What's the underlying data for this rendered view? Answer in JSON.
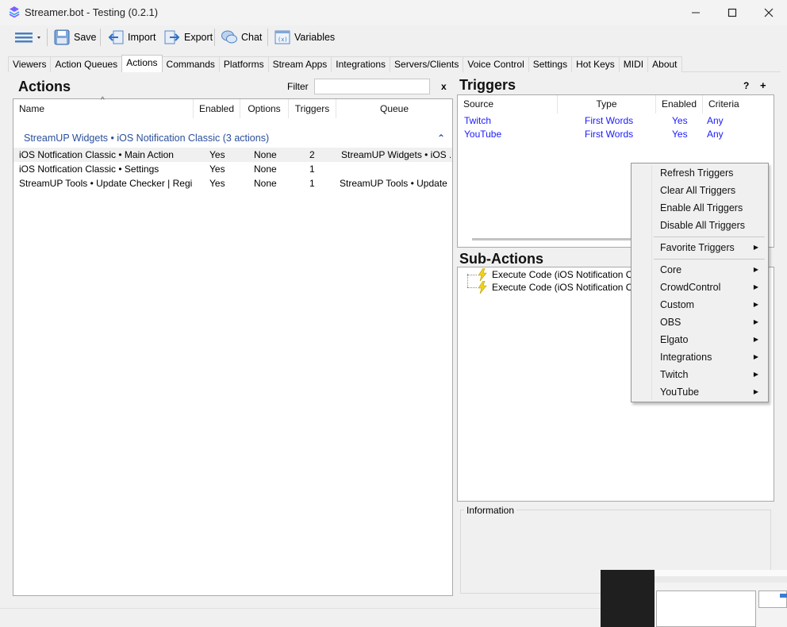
{
  "window": {
    "title": "Streamer.bot - Testing (0.2.1)",
    "minimize_glyph": "—",
    "maximize_glyph": "☐",
    "close_glyph": "✕"
  },
  "toolbar": {
    "save": "Save",
    "import": "Import",
    "export": "Export",
    "chat": "Chat",
    "variables": "Variables"
  },
  "tabs": [
    "Viewers",
    "Action Queues",
    "Actions",
    "Commands",
    "Platforms",
    "Stream Apps",
    "Integrations",
    "Servers/Clients",
    "Voice Control",
    "Settings",
    "Hot Keys",
    "MIDI",
    "About"
  ],
  "active_tab": "Actions",
  "actions": {
    "heading": "Actions",
    "filter_label": "Filter",
    "filter_value": "",
    "clear_filter": "x",
    "sort_indicator": "^",
    "columns": [
      "Name",
      "Enabled",
      "Options",
      "Triggers",
      "Queue"
    ],
    "group_title": "StreamUP Widgets • iOS Notification Classic (3 actions)",
    "group_collapse": "⌃",
    "rows": [
      {
        "name": "iOS Notfication Classic • Main Action",
        "enabled": "Yes",
        "options": "None",
        "triggers": "2",
        "queue": "StreamUP Widgets • iOS ..."
      },
      {
        "name": "iOS Notfication Classic • Settings",
        "enabled": "Yes",
        "options": "None",
        "triggers": "1",
        "queue": ""
      },
      {
        "name": "StreamUP Tools • Update Checker | Regist...",
        "enabled": "Yes",
        "options": "None",
        "triggers": "1",
        "queue": "StreamUP Tools • Update ..."
      }
    ]
  },
  "triggers": {
    "heading": "Triggers",
    "help": "?",
    "add": "+",
    "columns": [
      "Source",
      "Type",
      "Enabled",
      "Criteria"
    ],
    "rows": [
      {
        "source": "Twitch",
        "type": "First Words",
        "enabled": "Yes",
        "criteria": "Any"
      },
      {
        "source": "YouTube",
        "type": "First Words",
        "enabled": "Yes",
        "criteria": "Any"
      }
    ]
  },
  "sub_actions": {
    "heading": "Sub-Actions",
    "items": [
      "Execute Code (iOS Notification Classic",
      "Execute Code (iOS Notification Classic"
    ]
  },
  "information": {
    "label": "Information"
  },
  "context_menu": {
    "group1": [
      "Refresh Triggers",
      "Clear All Triggers",
      "Enable All Triggers",
      "Disable All Triggers"
    ],
    "favorite": "Favorite Triggers",
    "group3": [
      "Core",
      "CrowdControl",
      "Custom",
      "OBS",
      "Elgato",
      "Integrations",
      "Twitch",
      "YouTube"
    ],
    "arrow_glyph": "▶"
  },
  "colors": {
    "accent_blue": "#1a1aff",
    "group_blue": "#2a4f9a",
    "window_bg": "#f0f0f0"
  }
}
